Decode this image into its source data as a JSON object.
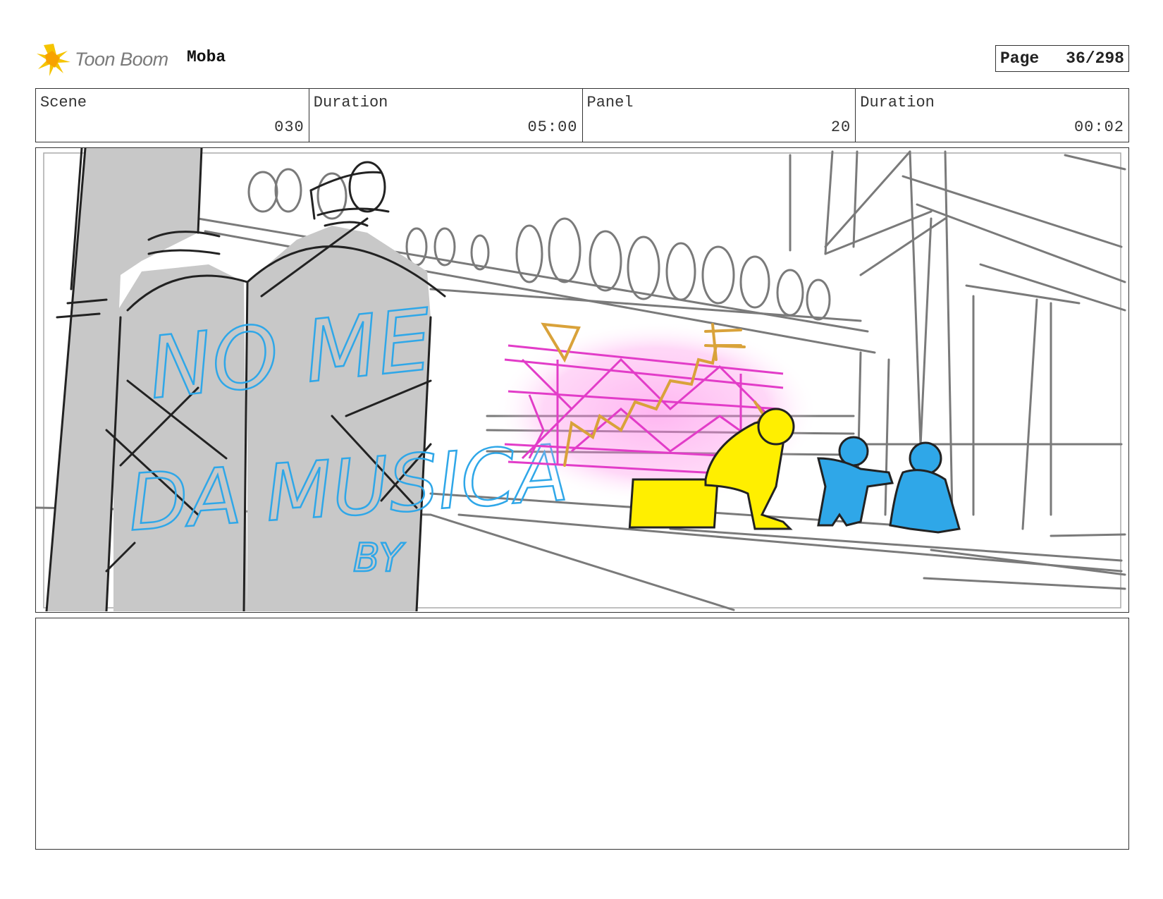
{
  "header": {
    "brand": "Toon Boom",
    "project": "Moba",
    "page_label": "Page",
    "page_value": "36/298"
  },
  "info": {
    "scene_label": "Scene",
    "scene_value": "030",
    "scene_duration_label": "Duration",
    "scene_duration_value": "05:00",
    "panel_label": "Panel",
    "panel_value": "20",
    "panel_duration_label": "Duration",
    "panel_duration_value": "00:02"
  },
  "graffiti": {
    "line1": "NO ME",
    "line2": "DA MUSICA",
    "line3": "BY"
  },
  "colors": {
    "sketch": "#7a7a7a",
    "ink": "#222222",
    "cans": "#c8c8c8",
    "graffiti_blue": "#2fa7e8",
    "mural_pink": "#e23cc8",
    "mural_gold": "#d9a23a",
    "figure_yellow": "#ffef00",
    "figure_blue": "#2fa7e8"
  },
  "notes": ""
}
